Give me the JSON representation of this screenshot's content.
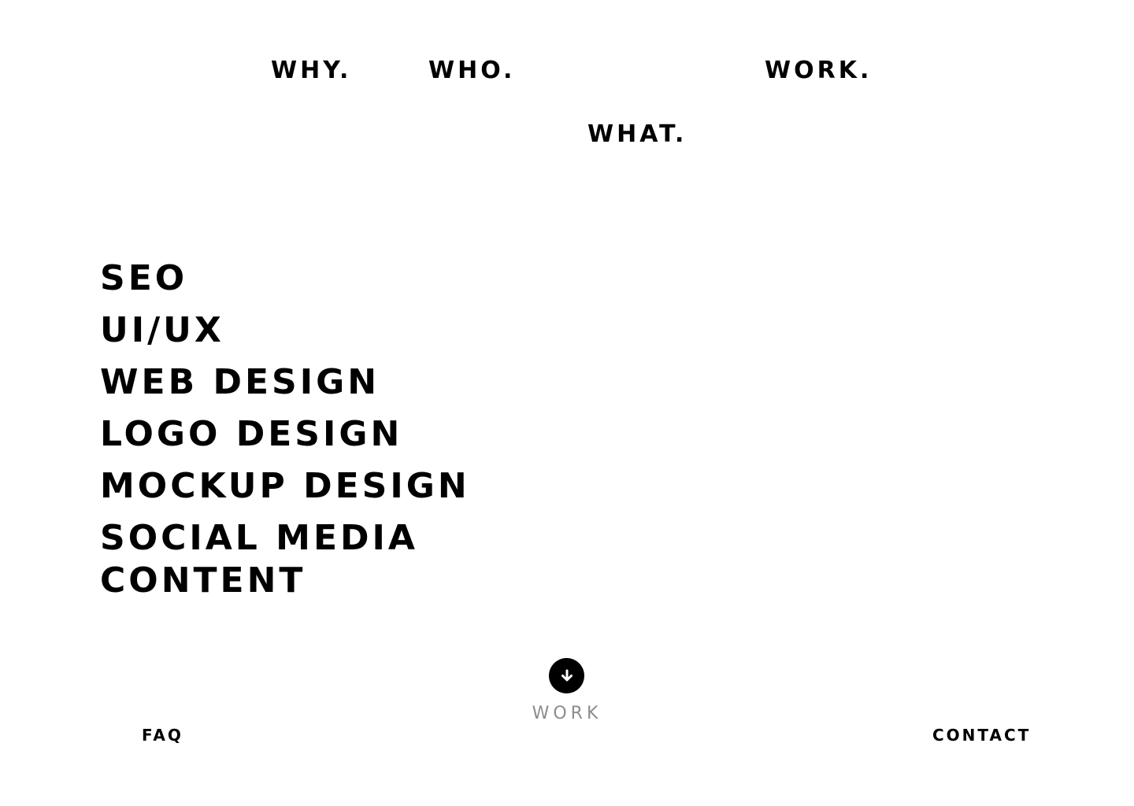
{
  "nav": {
    "why": "WHY.",
    "who": "WHO.",
    "what": "WHAT.",
    "work": "WORK."
  },
  "services": [
    "SEO",
    "UI/UX",
    "WEB DESIGN",
    "LOGO DESIGN",
    "MOCKUP DESIGN",
    "SOCIAL MEDIA CONTENT"
  ],
  "scroll_cta": {
    "icon": "arrow-down-icon",
    "label": "WORK"
  },
  "footer": {
    "faq": "FAQ",
    "contact": "CONTACT"
  },
  "colors": {
    "background": "#ffffff",
    "text": "#000000",
    "muted": "#8c8c8c"
  }
}
